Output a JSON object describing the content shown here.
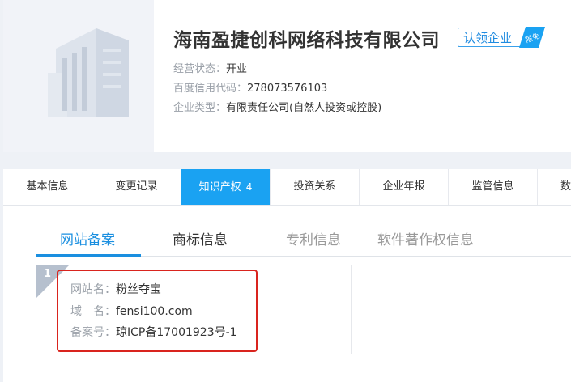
{
  "company": {
    "name": "海南盈捷创科网络科技有限公司",
    "claim_label": "认领企业",
    "claim_tag": "限免",
    "status_label": "经营状态：",
    "status_value": "开业",
    "credit_label": "百度信用代码：",
    "credit_value": "278073576103",
    "type_label": "企业类型：",
    "type_value": "有限责任公司(自然人投资或控股)"
  },
  "tabs": [
    {
      "label": "基本信息"
    },
    {
      "label": "变更记录"
    },
    {
      "label": "知识产权",
      "count": "4"
    },
    {
      "label": "投资关系"
    },
    {
      "label": "企业年报"
    },
    {
      "label": "监管信息"
    },
    {
      "label": "数"
    }
  ],
  "subtabs": [
    "网站备案",
    "商标信息",
    "专利信息",
    "软件著作权信息"
  ],
  "record": {
    "index": "1",
    "site_name_label": "网站名：",
    "site_name": "粉丝夺宝",
    "domain_label": "域　名：",
    "domain": "fensi100.com",
    "icp_label": "备案号：",
    "icp": "琼ICP备17001923号-1"
  },
  "colors": {
    "accent": "#1aa2f2",
    "highlight": "#d9241e"
  }
}
